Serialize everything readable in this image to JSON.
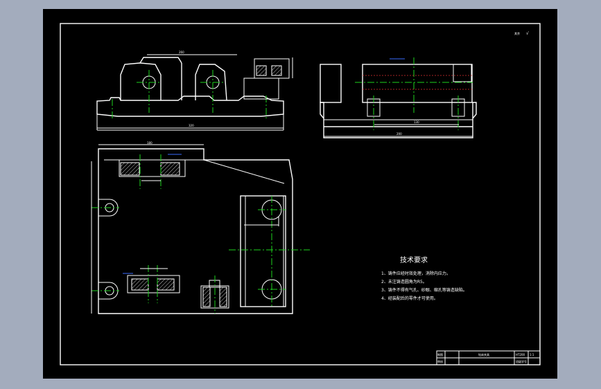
{
  "roughness_note": "其余",
  "roughness_symbol": "√",
  "technical_requirements": {
    "heading": "技术要求",
    "items": [
      "1、铸件应经时效处理，消除内应力。",
      "2、未注铸造圆角为R5。",
      "3、铸件不得有气孔、砂眼、缩孔等铸造缺陷。",
      "4、经装配后的零件才可使用。"
    ]
  },
  "title_block": {
    "drawing_name": "钻床夹具",
    "cell_draw": "制图",
    "cell_check": "审核",
    "school": "班级学号",
    "material": "HT200",
    "scale": "1:1"
  },
  "colors": {
    "background": "#000000",
    "outline": "#ffffff",
    "centerline": "#1ed31e",
    "dimension": "#3a6cff",
    "hidden": "#e03030"
  }
}
